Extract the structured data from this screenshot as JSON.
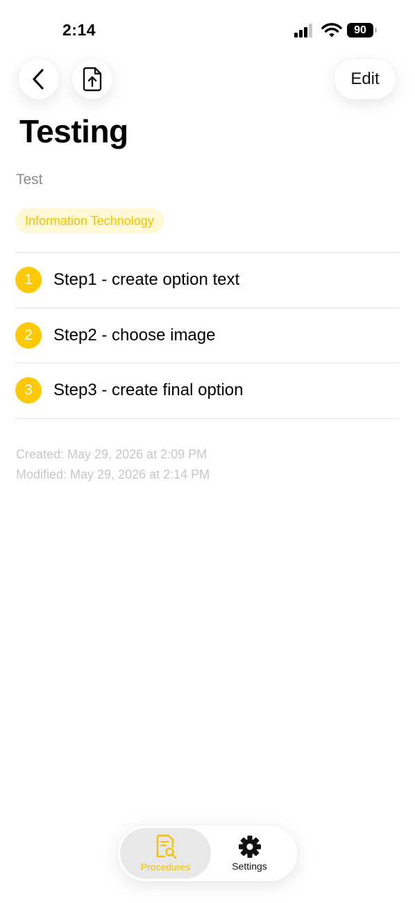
{
  "status_bar": {
    "time": "2:14",
    "battery": "90"
  },
  "nav": {
    "edit_label": "Edit"
  },
  "procedure": {
    "title": "Testing",
    "description": "Test",
    "category": "Information Technology",
    "steps": [
      {
        "number": "1",
        "text": "Step1 - create option text"
      },
      {
        "number": "2",
        "text": "Step2 - choose image"
      },
      {
        "number": "3",
        "text": "Step3 - create final option"
      }
    ],
    "created": "Created: May 29, 2026 at 2:09 PM",
    "modified": "Modified: May 29, 2026 at 2:14 PM"
  },
  "tab_bar": {
    "tabs": [
      {
        "label": "Procedures",
        "icon": "document-search-icon",
        "selected": true
      },
      {
        "label": "Settings",
        "icon": "gear-icon",
        "selected": false
      }
    ]
  },
  "colors": {
    "accent": "#fdc906",
    "tag_background": "#fff8d6",
    "tag_text": "#f2c200"
  }
}
